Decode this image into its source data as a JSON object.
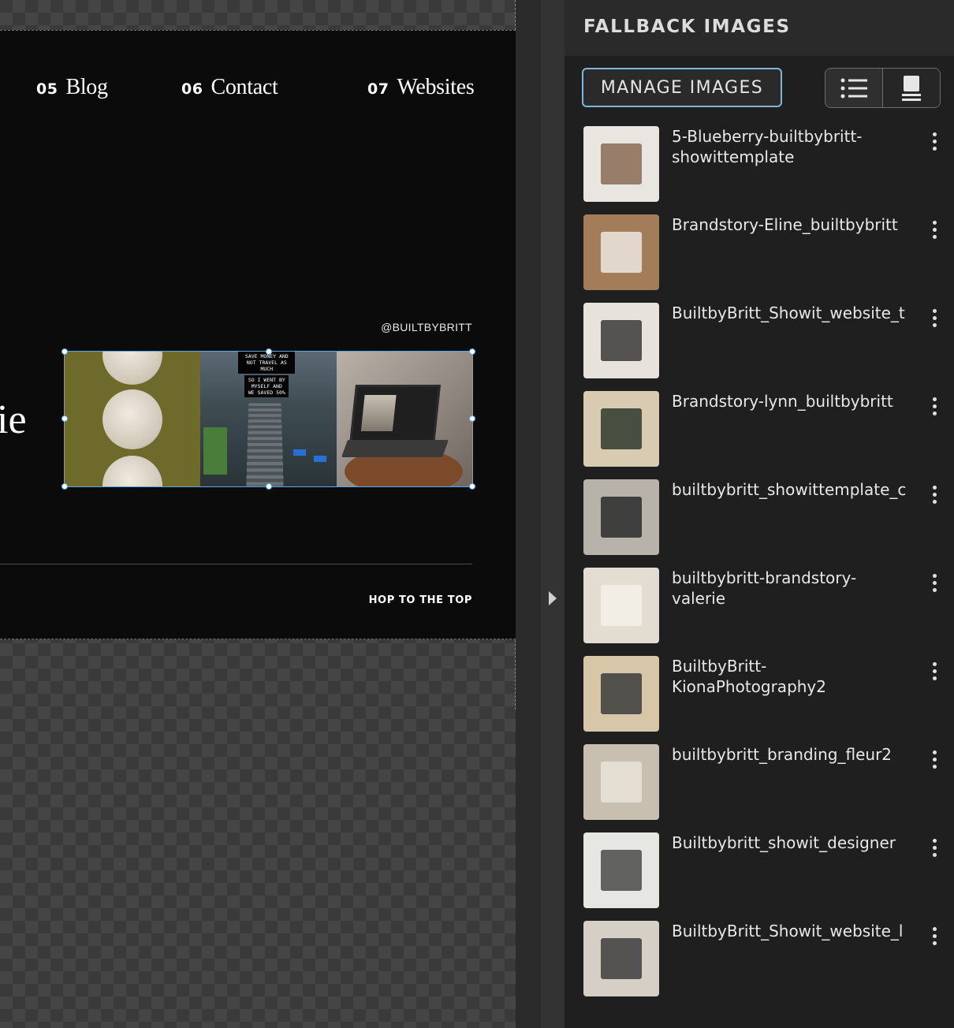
{
  "canvas": {
    "nav": [
      {
        "num": "05",
        "label": "Blog"
      },
      {
        "num": "06",
        "label": "Contact"
      },
      {
        "num": "07",
        "label": "Websites"
      }
    ],
    "handle": "@BUILTBYBRITT",
    "partial_glyph": "ie",
    "gallery_signs": [
      "SAVE MONEY AND NOT TRAVEL AS MUCH",
      "SO I WENT BY MYSELF AND WE SAVED 50%"
    ],
    "hop_to_top": "HOP TO THE TOP"
  },
  "panel": {
    "title": "FALLBACK IMAGES",
    "manage_button": "MANAGE IMAGES",
    "view_modes": [
      {
        "icon": "list-view-icon",
        "active": true
      },
      {
        "icon": "single-image-view-icon",
        "active": false
      }
    ],
    "images": [
      {
        "name": "5-Blueberry-builtbybritt-\nshowittemplate",
        "thumb_color": "#e9e6e1",
        "accent": "#8a6b55"
      },
      {
        "name": "Brandstory-Eline_builtbybritt",
        "thumb_color": "#a37d5a",
        "accent": "#ece7df"
      },
      {
        "name": "BuiltbyBritt_Showit_website_t",
        "thumb_color": "#e7e3dc",
        "accent": "#3a3a3a"
      },
      {
        "name": "Brandstory-lynn_builtbybritt",
        "thumb_color": "#d9cbb2",
        "accent": "#2f3a2c"
      },
      {
        "name": "builtbybritt_showittemplate_c",
        "thumb_color": "#b7b2aa",
        "accent": "#2a2a2a"
      },
      {
        "name": "builtbybritt-brandstory-\nvalerie",
        "thumb_color": "#e3ddd1",
        "accent": "#f4f1ea"
      },
      {
        "name": "BuiltbyBritt-\nKionaPhotography2",
        "thumb_color": "#d8c6a8",
        "accent": "#3b3b3b"
      },
      {
        "name": "builtbybritt_branding_fleur2",
        "thumb_color": "#c9bfb0",
        "accent": "#e9e3d9"
      },
      {
        "name": "Builtbybritt_showit_designer",
        "thumb_color": "#e6e6e3",
        "accent": "#4a4a4a"
      },
      {
        "name": "BuiltbyBritt_Showit_website_l",
        "thumb_color": "#d6cfc6",
        "accent": "#3d3d3d"
      }
    ]
  }
}
